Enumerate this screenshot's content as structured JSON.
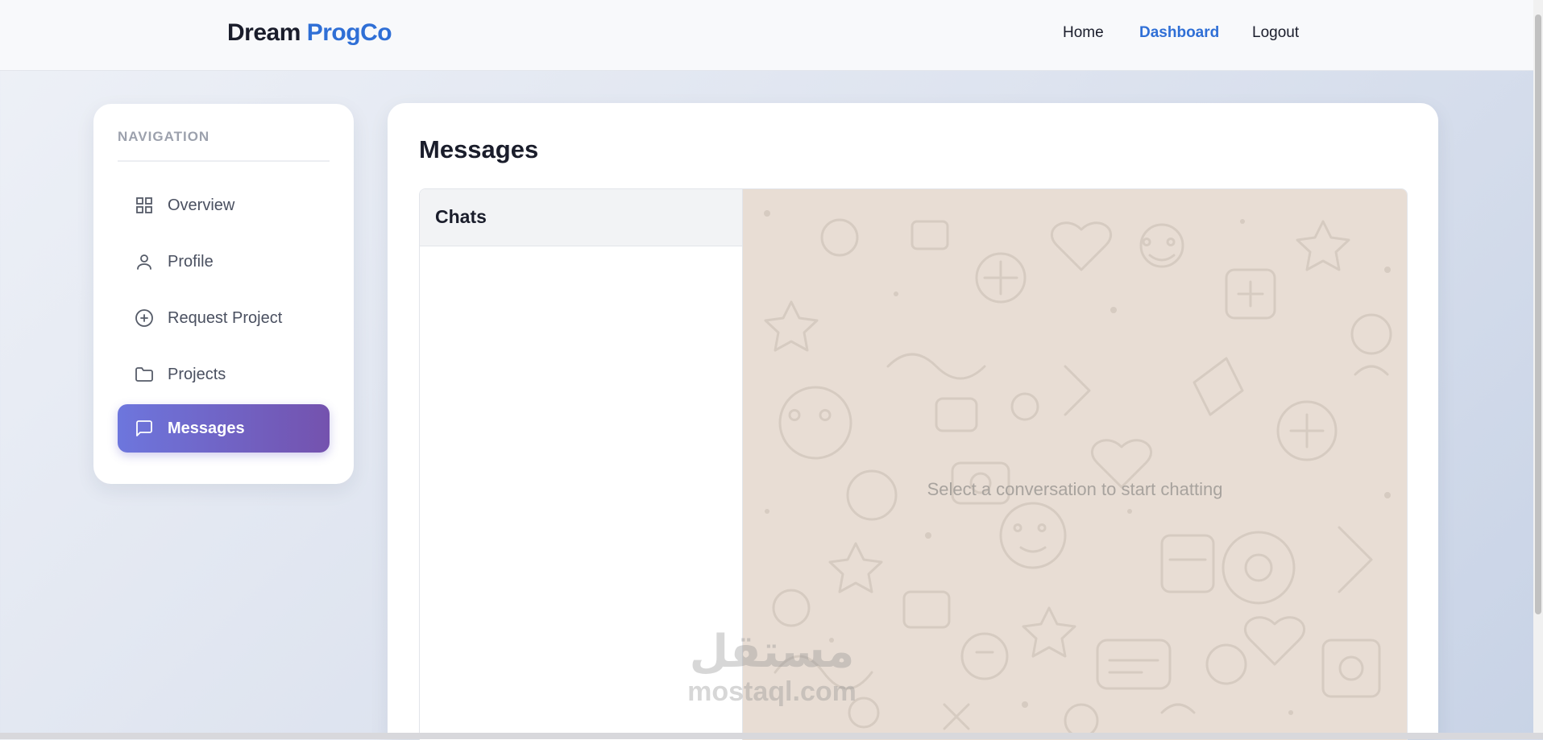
{
  "header": {
    "brand_part1": "Dream",
    "brand_part2": "ProgCo",
    "nav": [
      {
        "label": "Home",
        "active": false
      },
      {
        "label": "Dashboard",
        "active": true
      },
      {
        "label": "Logout",
        "active": false
      }
    ]
  },
  "sidebar": {
    "heading": "NAVIGATION",
    "items": [
      {
        "label": "Overview",
        "icon": "grid-icon"
      },
      {
        "label": "Profile",
        "icon": "user-icon"
      },
      {
        "label": "Request Project",
        "icon": "plus-circle-icon"
      },
      {
        "label": "Projects",
        "icon": "folder-icon"
      },
      {
        "label": "Messages",
        "icon": "message-square-icon",
        "active": true
      }
    ]
  },
  "main": {
    "title": "Messages",
    "chat_list_title": "Chats",
    "empty_state": "Select a conversation to start chatting"
  },
  "watermark": {
    "arabic": "مستقل",
    "latin": "mostaql.com"
  },
  "colors": {
    "accent": "#2f6fd6",
    "active_gradient_start": "#6d76dd",
    "active_gradient_end": "#7452ae",
    "chat_pane_bg": "#e8ddd4"
  }
}
